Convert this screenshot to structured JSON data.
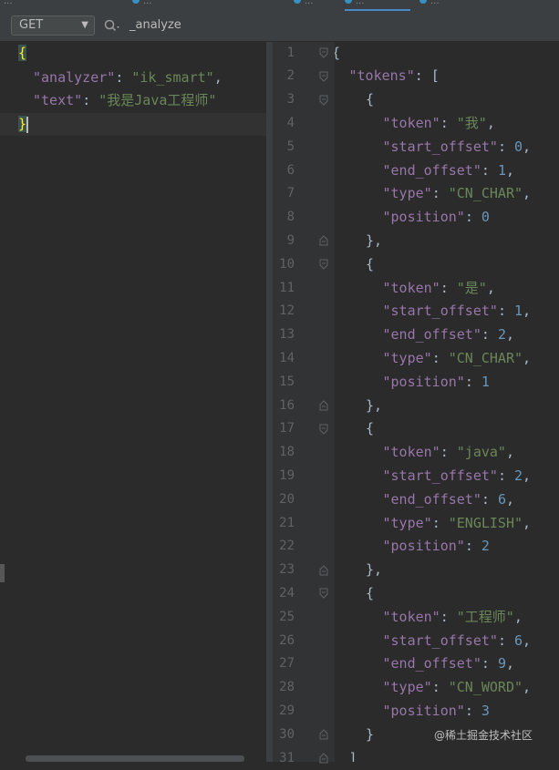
{
  "tabs": [
    {
      "label": "...",
      "active": false
    },
    {
      "label": "...",
      "active": false
    },
    {
      "label": "...",
      "active": true
    },
    {
      "label": "...",
      "active": false
    }
  ],
  "toolbar": {
    "method": "GET",
    "endpoint": "_analyze"
  },
  "request_body": [
    "{",
    "  \"analyzer\": \"ik_smart\",",
    "  \"text\": \"我是Java工程师\"",
    "}"
  ],
  "request": {
    "analyzer_key": "\"analyzer\"",
    "analyzer_val": "\"ik_smart\"",
    "text_key": "\"text\"",
    "text_val": "\"我是Java工程师\""
  },
  "response": {
    "line_numbers": [
      "1",
      "2",
      "3",
      "4",
      "5",
      "6",
      "7",
      "8",
      "9",
      "10",
      "11",
      "12",
      "13",
      "14",
      "15",
      "16",
      "17",
      "18",
      "19",
      "20",
      "21",
      "22",
      "23",
      "24",
      "25",
      "26",
      "27",
      "28",
      "29",
      "30",
      "31"
    ],
    "tokens_key": "\"tokens\"",
    "tokens": [
      {
        "token": "\"我\"",
        "start_offset": "0",
        "end_offset": "1",
        "type": "\"CN_CHAR\"",
        "position": "0"
      },
      {
        "token": "\"是\"",
        "start_offset": "1",
        "end_offset": "2",
        "type": "\"CN_CHAR\"",
        "position": "1"
      },
      {
        "token": "\"java\"",
        "start_offset": "2",
        "end_offset": "6",
        "type": "\"ENGLISH\"",
        "position": "2"
      },
      {
        "token": "\"工程师\"",
        "start_offset": "6",
        "end_offset": "9",
        "type": "\"CN_WORD\"",
        "position": "3"
      }
    ],
    "keys": {
      "token": "\"token\"",
      "start_offset": "\"start_offset\"",
      "end_offset": "\"end_offset\"",
      "type": "\"type\"",
      "position": "\"position\""
    }
  },
  "watermark": "@稀土掘金技术社区"
}
